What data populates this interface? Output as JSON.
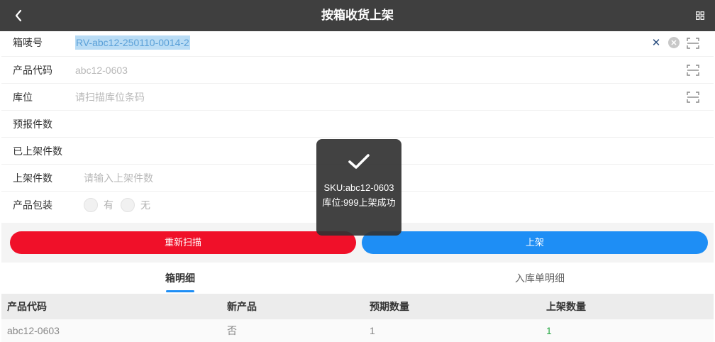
{
  "header": {
    "title": "按箱收货上架",
    "back_icon": "chevron-left-icon",
    "menu_icon": "grid-menu-icon"
  },
  "form": {
    "box_no": {
      "label": "箱唛号",
      "value": "RV-abc12-250110-0014-2"
    },
    "product_code": {
      "label": "产品代码",
      "placeholder": "abc12-0603"
    },
    "location": {
      "label": "库位",
      "placeholder": "请扫描库位条码"
    },
    "expected_qty": {
      "label": "预报件数",
      "value": ""
    },
    "shelved_qty": {
      "label": "已上架件数",
      "value": ""
    },
    "shelve_qty": {
      "label": "上架件数",
      "placeholder": "请输入上架件数"
    },
    "packaging": {
      "label": "产品包装",
      "options": [
        "有",
        "无"
      ]
    }
  },
  "buttons": {
    "rescan": "重新扫描",
    "shelve": "上架"
  },
  "tabs": {
    "box_detail": "箱明细",
    "inbound_detail": "入库单明细"
  },
  "table": {
    "headers": [
      "产品代码",
      "新产品",
      "预期数量",
      "上架数量"
    ],
    "rows": [
      [
        "abc12-0603",
        "否",
        "1",
        "1"
      ]
    ]
  },
  "toast": {
    "message": "SKU:abc12-0603库位:999上架成功"
  },
  "colors": {
    "accent_blue": "#1e8ef5",
    "danger_red": "#f01029",
    "success_green": "#27a844"
  }
}
